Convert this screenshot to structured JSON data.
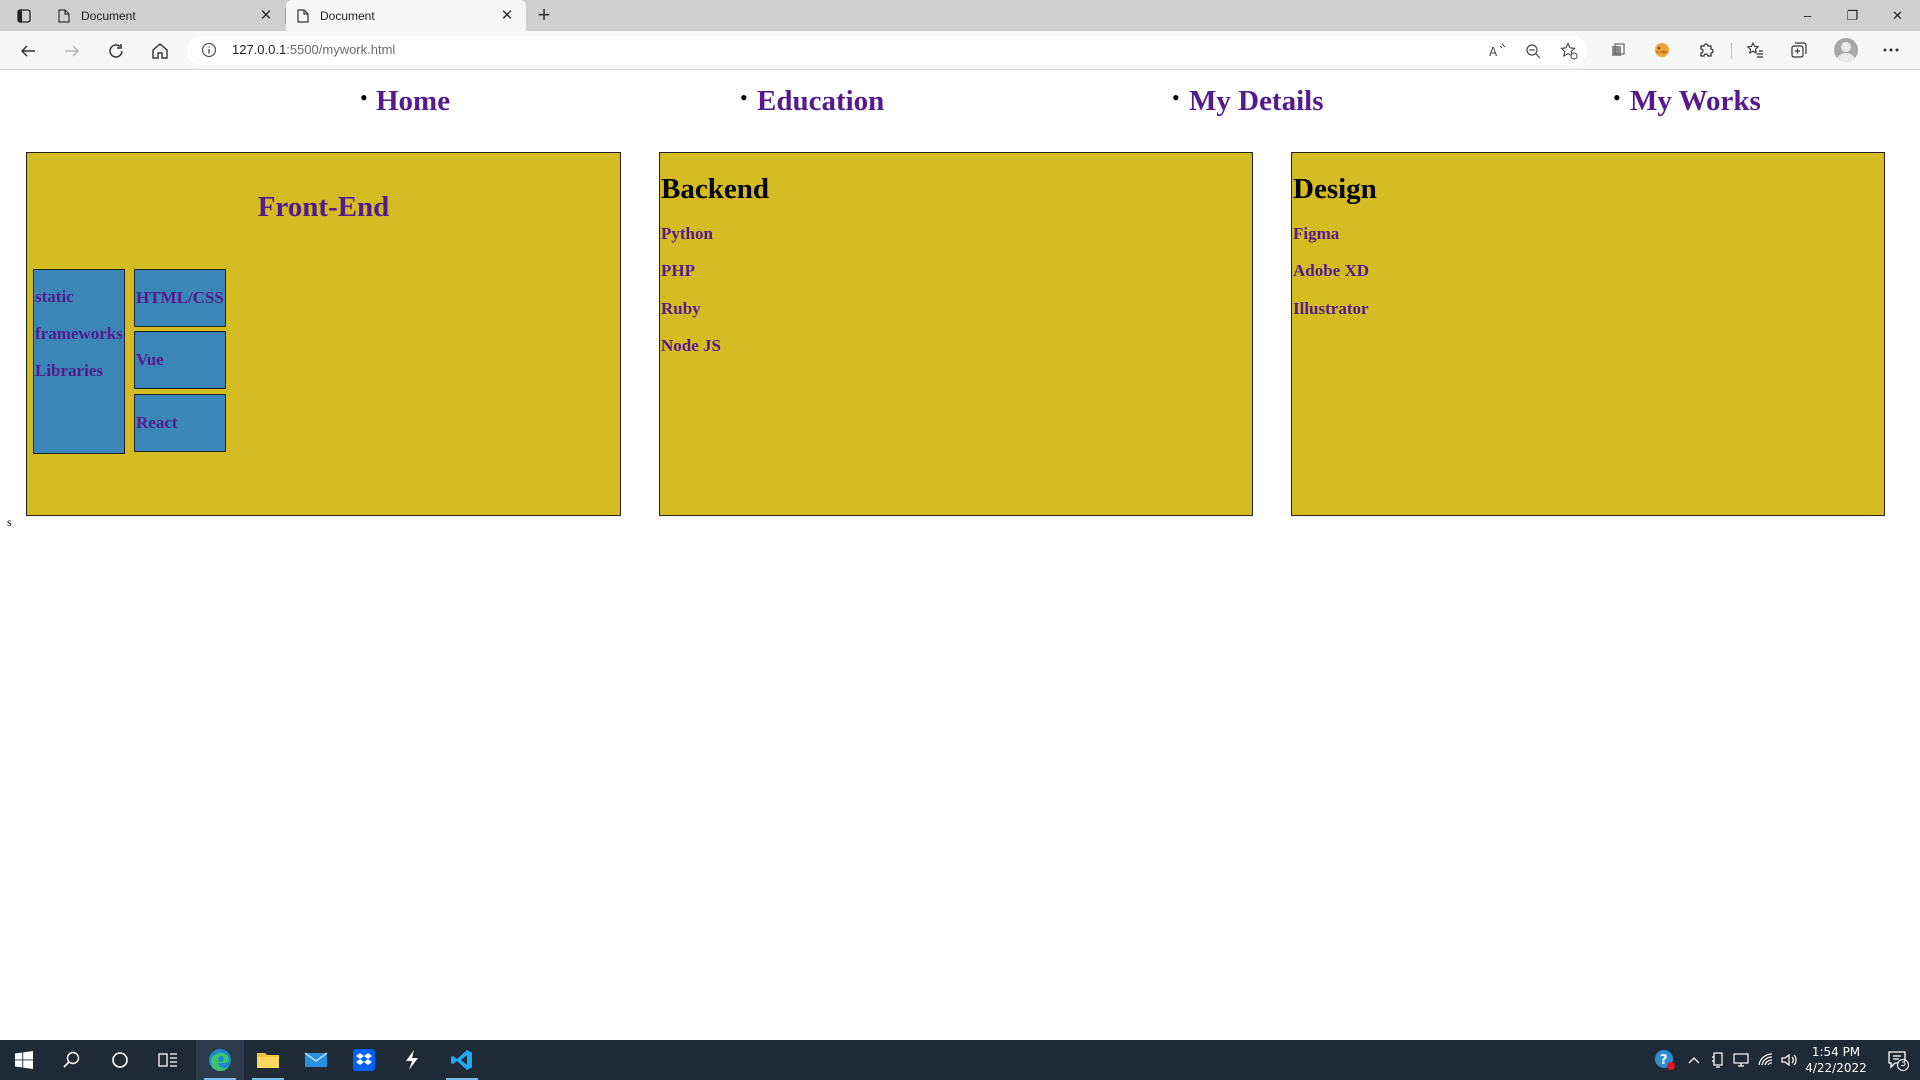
{
  "browser": {
    "tabs": [
      {
        "title": "Document",
        "active": false
      },
      {
        "title": "Document",
        "active": true
      }
    ],
    "new_tab_label": "+",
    "address": {
      "host": "127.0.0.1",
      "path": ":5500/mywork.html"
    },
    "window_controls": {
      "minimize": "–",
      "restore": "❐",
      "close": "✕"
    }
  },
  "page": {
    "nav": [
      "Home",
      "Education",
      "My Details",
      "My Works"
    ],
    "frontend": {
      "title": "Front-End",
      "categories": [
        "static",
        "frameworks",
        "Libraries"
      ],
      "items": [
        "HTML/CSS",
        "Vue",
        "React"
      ]
    },
    "backend": {
      "title": "Backend",
      "items": [
        "Python",
        "PHP",
        "Ruby",
        "Node JS"
      ]
    },
    "design": {
      "title": "Design",
      "items": [
        "Figma",
        "Adobe XD",
        "Illustrator"
      ]
    },
    "stray_text": "s"
  },
  "taskbar": {
    "clock_time": "1:54 PM",
    "clock_date": "4/22/2022",
    "notification_count": "3"
  },
  "colors": {
    "card_bg": "#d4bb22",
    "box_bg": "#3a86b8",
    "link": "#551a8b",
    "taskbar": "#1f2a37"
  }
}
